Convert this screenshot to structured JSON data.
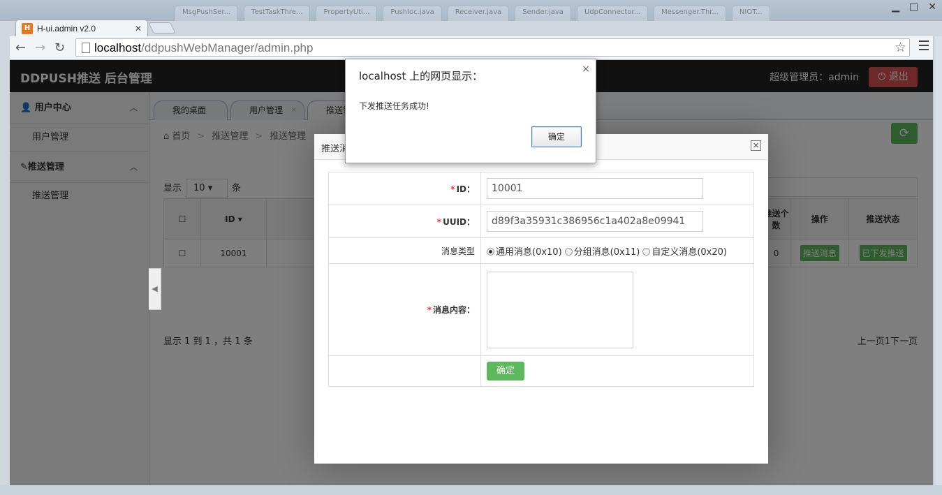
{
  "browser": {
    "tab_title": "H-ui.admin v2.0",
    "url_host": "localhost",
    "url_path": "/ddpushWebManager/admin.php",
    "background_tabs": [
      "MsgPushSer...",
      "TestTaskThre...",
      "PropertyUti...",
      "PushIoc.java",
      "Receiver.java",
      "Sender.java",
      "UdpConnector...",
      "Messenger.Thr...",
      "NIOT..."
    ]
  },
  "header": {
    "brand": "DDPUSH推送 后台管理",
    "admin_label": "超级管理员：admin",
    "logout_label": "退出"
  },
  "sidebar": {
    "groups": [
      {
        "title": "用户中心",
        "items": [
          "用户管理"
        ]
      },
      {
        "title": "推送管理",
        "items": [
          "推送管理"
        ]
      }
    ]
  },
  "tabs": [
    "我的桌面",
    "用户管理",
    "推送管"
  ],
  "breadcrumb": [
    "首页",
    "推送管理",
    "推送管理"
  ],
  "table": {
    "length_prefix": "显示",
    "length_value": "10",
    "length_suffix": "条",
    "columns": {
      "id": "ID",
      "push_count": "推送个数",
      "action": "操作",
      "status": "推送状态"
    },
    "row": {
      "id": "10001",
      "push_count": "0",
      "action": "推送消息",
      "status": "已下发推送"
    },
    "info": "显示 1 到 1 ，共 1 条",
    "paging": "上一页1下一页"
  },
  "layer": {
    "title": "推送消",
    "form": {
      "id_label": "ID：",
      "id_value": "10001",
      "uuid_label": "UUID：",
      "uuid_value": "d89f3a35931c386956c1a402a8e09941",
      "type_label": "消息类型",
      "type_options": [
        "通用消息(0x10)",
        "分组消息(0x11)",
        "自定义消息(0x20)"
      ],
      "type_selected": 0,
      "content_label": "消息内容：",
      "submit_label": "确定"
    }
  },
  "alert": {
    "title": "localhost 上的网页显示：",
    "message": "下发推送任务成功!",
    "ok_label": "确定"
  },
  "colors": {
    "header_bg": "#222222",
    "danger": "#d9534f",
    "success": "#5eb95e",
    "required": "#ee3333"
  }
}
